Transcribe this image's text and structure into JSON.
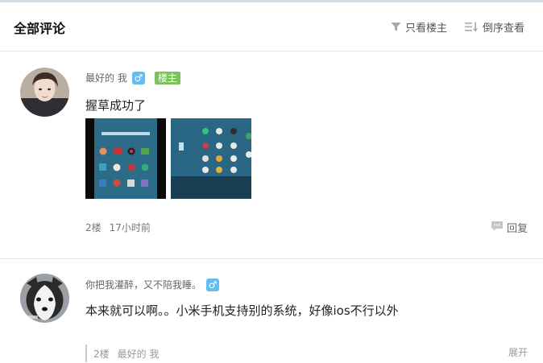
{
  "header": {
    "title": "全部评论",
    "filter_label": "只看楼主",
    "reverse_label": "倒序查看"
  },
  "comments": [
    {
      "username": "最好的 我",
      "gender_symbol": "♂",
      "op_badge": "楼主",
      "text": "握草成功了",
      "floor": "2楼",
      "time": "17小时前",
      "reply_label": "回复",
      "images": [
        "phone-screenshot-1",
        "phone-screenshot-2"
      ]
    },
    {
      "username": "你把我灌醉，又不陪我睡。",
      "gender_symbol": "♂",
      "text": "本来就可以啊。。小米手机支持别的系统，好像ios不行以外",
      "sub_reply": {
        "floor": "2楼",
        "username": "最好的 我"
      },
      "expand_label": "展开"
    }
  ],
  "colors": {
    "gender_badge": "#64bdf1",
    "op_badge": "#7ac35b",
    "divider": "#e8e8e8"
  }
}
